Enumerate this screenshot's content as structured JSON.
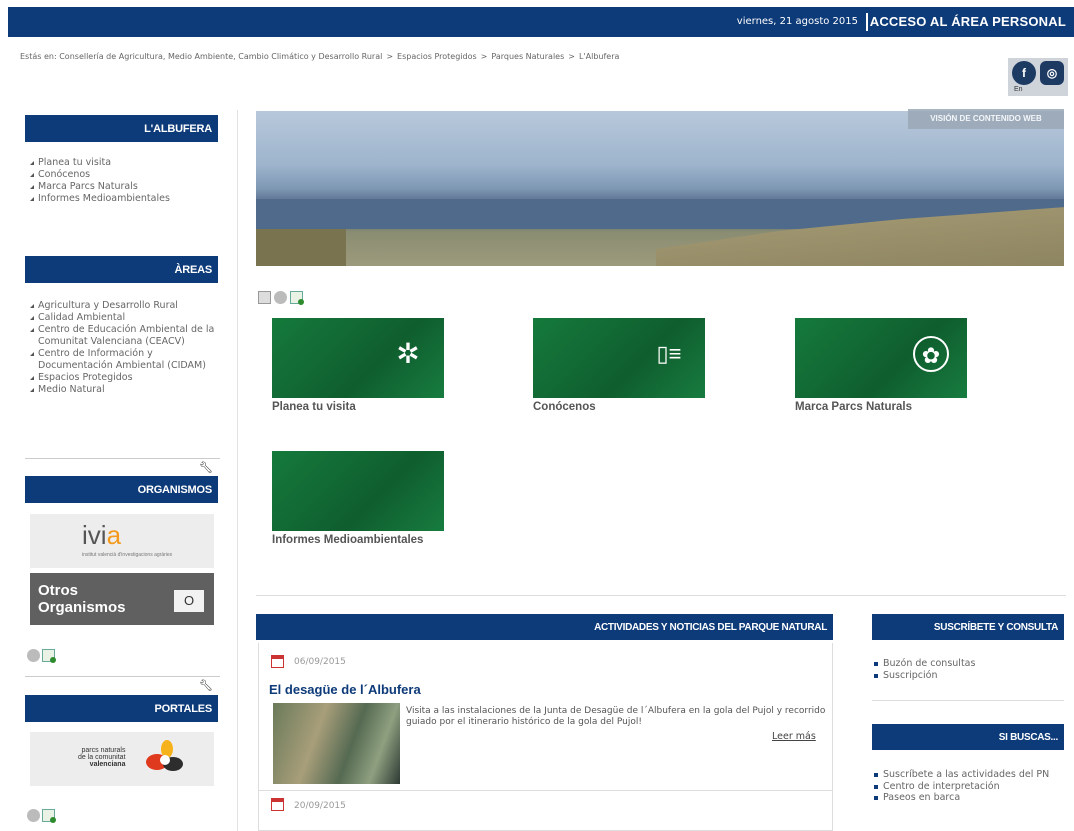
{
  "topbar": {
    "date": "viernes, 21 agosto 2015",
    "personal": "ACCESO AL ÁREA PERSONAL"
  },
  "breadcrumb": {
    "prefix": "Estás en:",
    "items": [
      "Consellería de Agricultura, Medio Ambiente, Cambio Climático y Desarrollo Rural",
      "Espacios Protegidos",
      "Parques Naturales",
      "L'Albufera"
    ]
  },
  "social": {
    "fb": "f",
    "ig": "◎",
    "label": "En"
  },
  "sidebar": {
    "albufera": {
      "title": "L'ALBUFERA",
      "items": [
        "Planea tu visita",
        "Conócenos",
        "Marca Parcs Naturals",
        "Informes Medioambientales"
      ]
    },
    "areas": {
      "title": "ÀREAS",
      "items": [
        "Agricultura y Desarrollo Rural",
        "Calidad Ambiental",
        "Centro de Educación Ambiental de la Comunitat Valenciana (CEACV)",
        "Centro de Información y Documentación Ambiental (CIDAM)",
        "Espacios Protegidos",
        "Medio Natural"
      ]
    },
    "organismos": {
      "title": "ORGANISMOS",
      "ivia_main": "ivi",
      "ivia_accent": "a",
      "ivia_sub": "institut valencià d'investigacions agràries",
      "otros_line1": "Otros",
      "otros_line2": "Organismos",
      "otros_btn": "O"
    },
    "portales": {
      "title": "PORTALES",
      "pn_line1": "parcs naturals",
      "pn_line2": "de la comunitat",
      "pn_line3": "valenciana"
    }
  },
  "banner": {
    "vision": "VISIÓN DE CONTENIDO WEB"
  },
  "tiles": [
    {
      "label": "Planea tu visita",
      "icon": "compass-icon",
      "glyph": "✲"
    },
    {
      "label": "Conócenos",
      "icon": "info-lines-icon",
      "glyph": "▯≡"
    },
    {
      "label": "Marca Parcs Naturals",
      "icon": "leaf-flower-icon",
      "glyph": "✿"
    },
    {
      "label": "Informes Medioambientales",
      "icon": "none",
      "glyph": ""
    }
  ],
  "news": {
    "header": "ACTIVIDADES Y NOTICIAS DEL PARQUE NATURAL",
    "item1": {
      "date": "06/09/2015",
      "title": "El desagüe de l´Albufera",
      "text": "Visita a las instalaciones de la Junta de Desagüe de l´Albufera en la gola del Pujol y recorrido guiado por el itinerario histórico de la gola del Pujol!",
      "more": "Leer más"
    },
    "item2": {
      "date": "20/09/2015"
    }
  },
  "right": {
    "sub_title": "SUSCRÍBETE Y CONSULTA",
    "sub_items": [
      "Buzón de consultas",
      "Suscripción"
    ],
    "busca_title": "SI BUSCAS...",
    "busca_items": [
      "Suscríbete a las actividades del PN",
      "Centro de interpretación",
      "Paseos en barca"
    ]
  }
}
